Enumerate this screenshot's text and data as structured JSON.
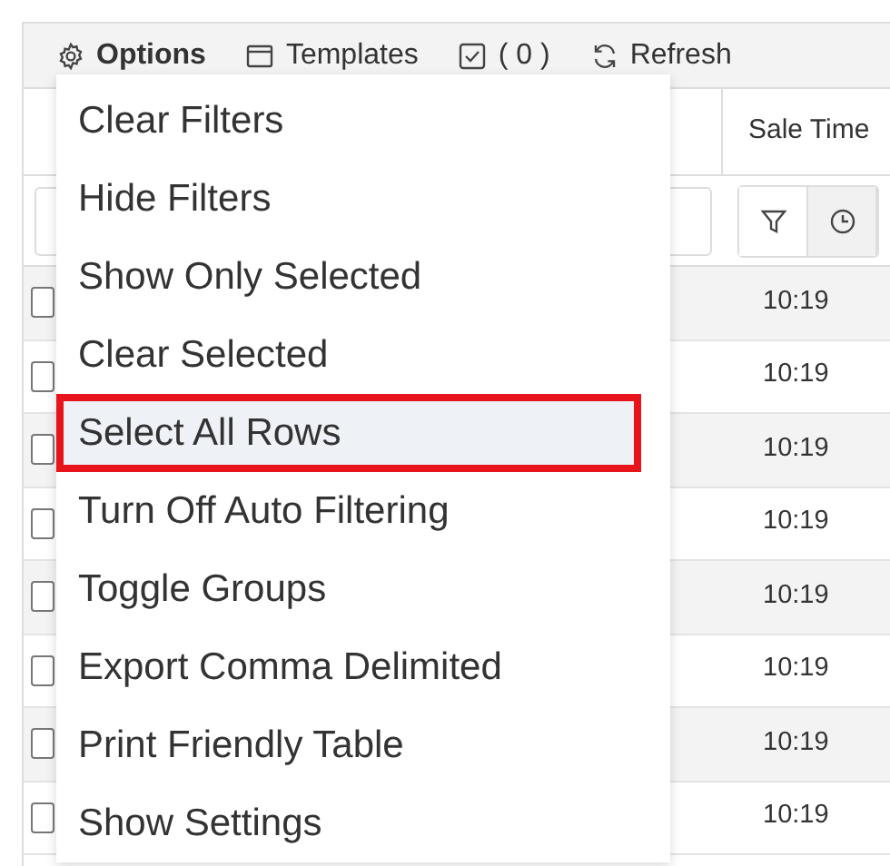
{
  "toolbar": [
    {
      "kind": "options",
      "label": "Options"
    },
    {
      "kind": "templates",
      "label": "Templates"
    },
    {
      "kind": "selected",
      "label": "( 0 )"
    },
    {
      "kind": "refresh",
      "label": "Refresh"
    }
  ],
  "table": {
    "columns": [
      {
        "label": "Sale Time"
      }
    ],
    "filter_row": {
      "buttons": [
        {
          "kind": "filter"
        },
        {
          "kind": "clock"
        }
      ]
    },
    "rows": [
      {
        "checked": false,
        "sale_time": "10:19"
      },
      {
        "checked": false,
        "sale_time": "10:19"
      },
      {
        "checked": false,
        "sale_time": "10:19"
      },
      {
        "checked": false,
        "sale_time": "10:19"
      },
      {
        "checked": false,
        "sale_time": "10:19"
      },
      {
        "checked": false,
        "sale_time": "10:19"
      },
      {
        "checked": false,
        "sale_time": "10:19"
      },
      {
        "checked": false,
        "sale_time": "10:19"
      }
    ]
  },
  "options_menu": {
    "items": [
      {
        "label": "Clear Filters",
        "highlighted": false
      },
      {
        "label": "Hide Filters",
        "highlighted": false
      },
      {
        "label": "Show Only Selected",
        "highlighted": false
      },
      {
        "label": "Clear Selected",
        "highlighted": false
      },
      {
        "label": "Select All Rows",
        "highlighted": true
      },
      {
        "label": "Turn Off Auto Filtering",
        "highlighted": false
      },
      {
        "label": "Toggle Groups",
        "highlighted": false
      },
      {
        "label": "Export Comma Delimited",
        "highlighted": false
      },
      {
        "label": "Print Friendly Table",
        "highlighted": false
      },
      {
        "label": "Show Settings",
        "highlighted": false
      }
    ]
  }
}
